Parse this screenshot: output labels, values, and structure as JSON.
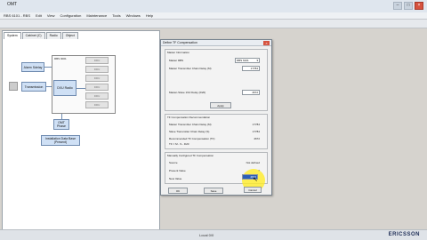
{
  "window": {
    "title": "OMT"
  },
  "menu": [
    "RBS 6101 - RBS",
    "Edit",
    "View",
    "Configuration",
    "Maintenance",
    "Tools",
    "Windows",
    "Help"
  ],
  "left_panel": {
    "tabs": [
      "System",
      "Cabinet (C)",
      "Radio",
      "Object"
    ],
    "nodes": {
      "alarm": "Alarm Sdelay",
      "transmission": "Transmission",
      "rbs_label": "RBS 0001",
      "dxu": "DXU Radio",
      "omt": "OMT Phase",
      "install_db": "Installation Data Base (Present)"
    },
    "slot_label": "DRU"
  },
  "dialog": {
    "title": "Define TF Compensation",
    "info_group": {
      "title": "Master Information",
      "master_rbs_label": "Master RBS",
      "master_rbs_value": "RBS 6101",
      "chain_delay_label": "Master Transmitter Chain Delay (M)",
      "chain_delay_value": "17784",
      "cable_delay_label": "Master-Slave 1/10 Delay (D20)",
      "cable_delay_value": "4672",
      "apply_label": "Apply"
    },
    "recommend_group": {
      "title": "TF Compensation Recommendation",
      "master_chain_label": "Master Transmitter Chain Delay (M)",
      "master_chain_value": "17784",
      "slave_chain_label": "Slave Transmitter Chain Delay (S)",
      "slave_chain_value": "17784",
      "recommended_label": "Recommended TF Compensation (TF)",
      "recommended_value": "4672",
      "formula_label": "TF = M - S - D20"
    },
    "manual_group": {
      "title": "Manually Configured TF Compensation",
      "source_label": "Source",
      "source_value": "Not defined",
      "present_label": "Present Value",
      "present_value": "0",
      "new_label": "New Value",
      "new_value": "4672"
    },
    "buttons": {
      "ok": "OK",
      "save": "Save",
      "cancel": "Cancel"
    }
  },
  "status": {
    "text": "Local 0/0",
    "brand": "ERICSSON"
  }
}
